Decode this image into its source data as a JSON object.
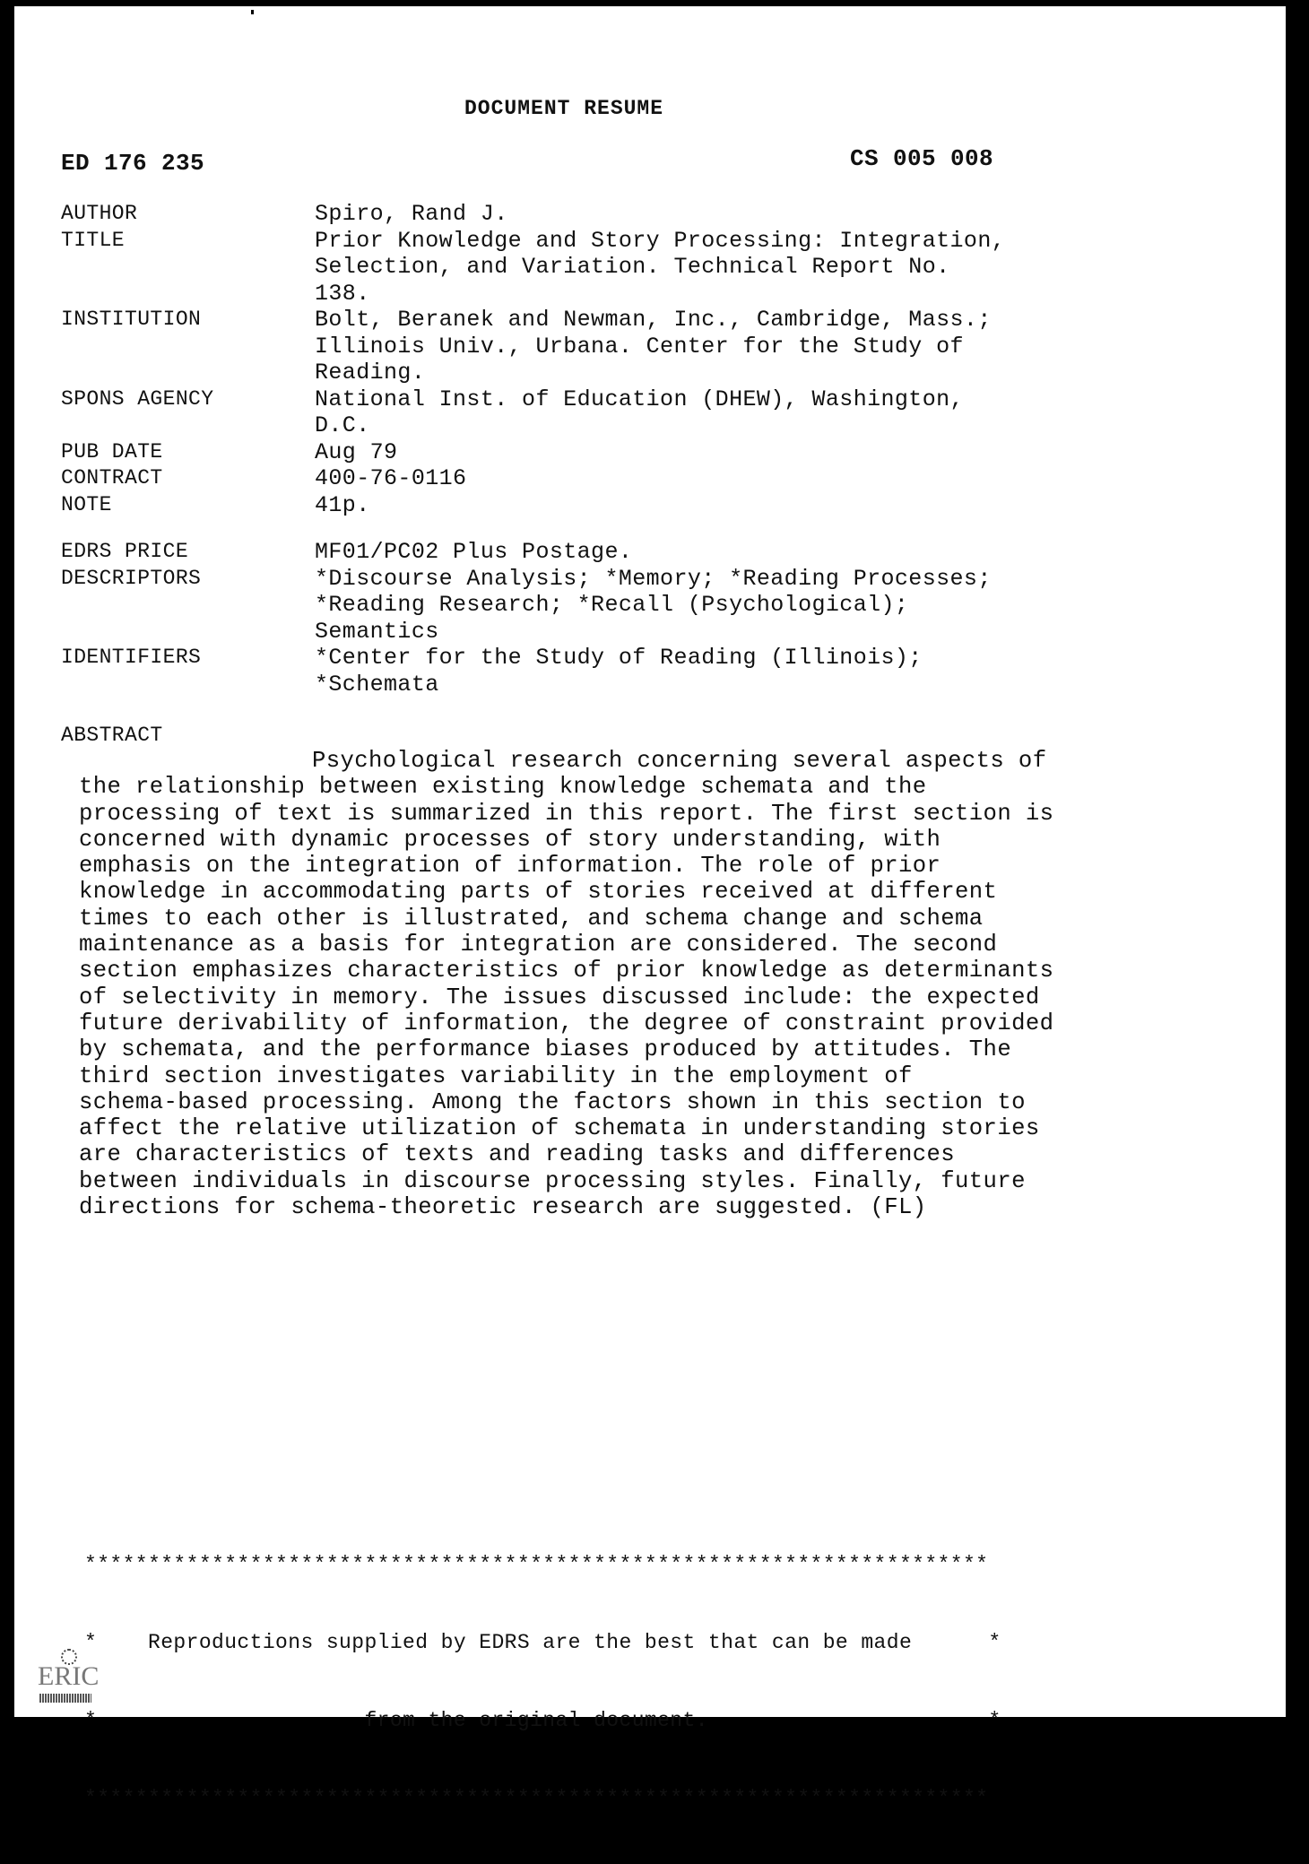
{
  "header": {
    "title": "DOCUMENT RESUME",
    "ed_number": "ED 176 235",
    "cs_number": "CS 005 008"
  },
  "fields": [
    {
      "label": "AUTHOR",
      "lines": [
        "Spiro, Rand J."
      ]
    },
    {
      "label": "TITLE",
      "lines": [
        "Prior Knowledge and Story Processing: Integration,",
        "Selection, and Variation. Technical Report No.",
        "138."
      ]
    },
    {
      "label": "INSTITUTION",
      "lines": [
        "Bolt, Beranek and Newman, Inc., Cambridge, Mass.;",
        "Illinois Univ., Urbana. Center for the Study of",
        "Reading."
      ]
    },
    {
      "label": "SPONS AGENCY",
      "lines": [
        "National Inst. of Education (DHEW), Washington,",
        "D.C."
      ]
    },
    {
      "label": "PUB DATE",
      "lines": [
        "Aug 79"
      ]
    },
    {
      "label": "CONTRACT",
      "lines": [
        "400-76-0116"
      ]
    },
    {
      "label": "NOTE",
      "lines": [
        "41p."
      ]
    }
  ],
  "fields2": [
    {
      "label": "EDRS PRICE",
      "lines": [
        "MF01/PC02 Plus Postage."
      ]
    },
    {
      "label": "DESCRIPTORS",
      "lines": [
        "*Discourse Analysis; *Memory; *Reading Processes;",
        "*Reading Research; *Recall (Psychological);",
        "Semantics"
      ]
    },
    {
      "label": "IDENTIFIERS",
      "lines": [
        "*Center for the Study of Reading (Illinois);",
        "*Schemata"
      ]
    }
  ],
  "abstract": {
    "label": "ABSTRACT",
    "lines": [
      "Psychological research concerning several aspects of",
      "the relationship between existing knowledge schemata and the",
      "processing of text is summarized in this report. The first section is",
      "concerned with dynamic processes of story understanding, with",
      "emphasis on the integration of information. The role of prior",
      "knowledge in accommodating parts of stories received at different",
      "times to each other is illustrated, and schema change and schema",
      "maintenance as a basis for integration are considered. The second",
      "section emphasizes characteristics of prior knowledge as determinants",
      "of selectivity in memory. The issues discussed include: the expected",
      "future derivability of information, the degree of constraint provided",
      "by schemata, and the performance biases produced by attitudes. The",
      "third section investigates variability in the employment of",
      "schema-based processing. Among the factors shown in this section to",
      "affect the relative utilization of schemata in understanding stories",
      "are characteristics of texts and reading tasks and differences",
      "between individuals in discourse processing styles. Finally, future",
      "directions for schema-theoretic research are suggested. (FL)"
    ]
  },
  "notice": {
    "border": "***********************************************************************",
    "line1": "*    Reproductions supplied by EDRS are the best that can be made      *",
    "line2": "*                     from the original document.                      *"
  },
  "logo": {
    "text": "ERIC"
  }
}
